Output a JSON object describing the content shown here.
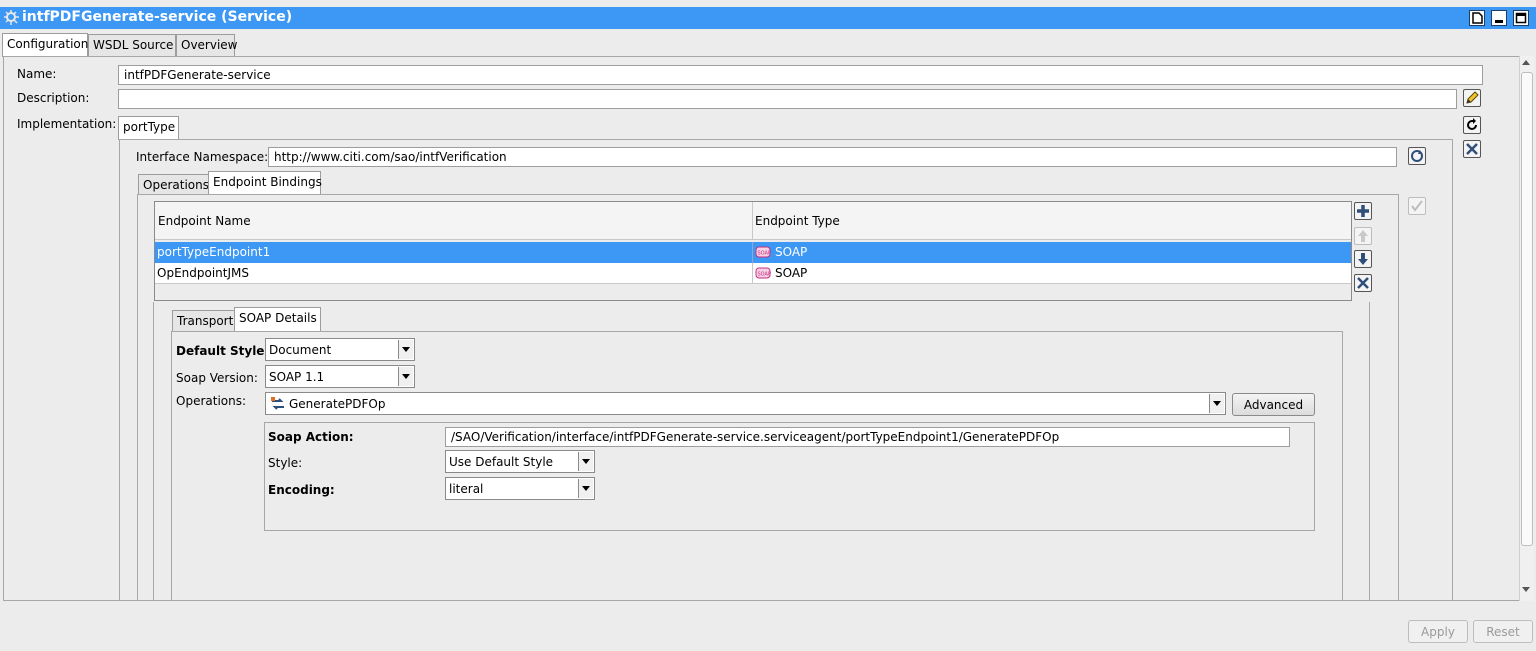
{
  "window": {
    "title": "intfPDFGenerate-service (Service)"
  },
  "tabs": [
    "Configuration",
    "WSDL Source",
    "Overview"
  ],
  "form": {
    "name_label": "Name:",
    "name_value": "intfPDFGenerate-service",
    "description_label": "Description:",
    "description_value": "",
    "implementation_label": "Implementation:"
  },
  "implementation": {
    "tab": "portType",
    "namespace_label": "Interface Namespace:",
    "namespace_value": "http://www.citi.com/sao/intfVerification",
    "subtabs": [
      "Operations",
      "Endpoint Bindings"
    ]
  },
  "endpoints": {
    "headers": [
      "Endpoint Name",
      "Endpoint Type"
    ],
    "rows": [
      {
        "name": "portTypeEndpoint1",
        "type": "SOAP",
        "selected": true
      },
      {
        "name": "OpEndpointJMS",
        "type": "SOAP",
        "selected": false
      }
    ]
  },
  "details": {
    "tabs": [
      "Transport",
      "SOAP Details"
    ],
    "default_style_label": "Default Style:",
    "default_style_value": "Document",
    "soap_version_label": "Soap Version:",
    "soap_version_value": "SOAP 1.1",
    "operations_label": "Operations:",
    "operations_value": "GeneratePDFOp",
    "advanced_label": "Advanced",
    "soap_action_label": "Soap Action:",
    "soap_action_value": "/SAO/Verification/interface/intfPDFGenerate-service.serviceagent/portTypeEndpoint1/GeneratePDFOp",
    "style_label": "Style:",
    "style_value": "Use Default Style",
    "encoding_label": "Encoding:",
    "encoding_value": "literal"
  },
  "footer": {
    "apply_label": "Apply",
    "reset_label": "Reset"
  },
  "colors": {
    "titlebar": "#3d98f5",
    "selection": "#3d98f5"
  }
}
